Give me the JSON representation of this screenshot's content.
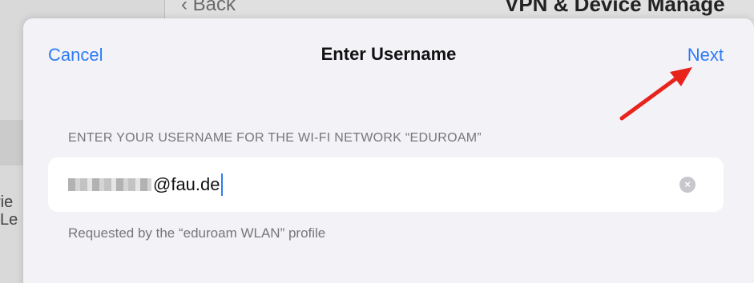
{
  "background": {
    "back_label": "Back",
    "page_title": "VPN & Device Manage",
    "side_text_1": "rie",
    "side_text_2": "Le"
  },
  "sheet": {
    "cancel_label": "Cancel",
    "title": "Enter Username",
    "next_label": "Next",
    "section_header": "ENTER YOUR USERNAME FOR THE WI-FI NETWORK “EDUROAM”",
    "field_value": "@fau.de",
    "clear_icon": "×",
    "footer": "Requested by the “eduroam WLAN” profile"
  },
  "annotation": {
    "arrow_color": "#e8231c"
  },
  "colors": {
    "accent": "#2f7bf5",
    "sheet_bg": "#f2f2f7"
  }
}
